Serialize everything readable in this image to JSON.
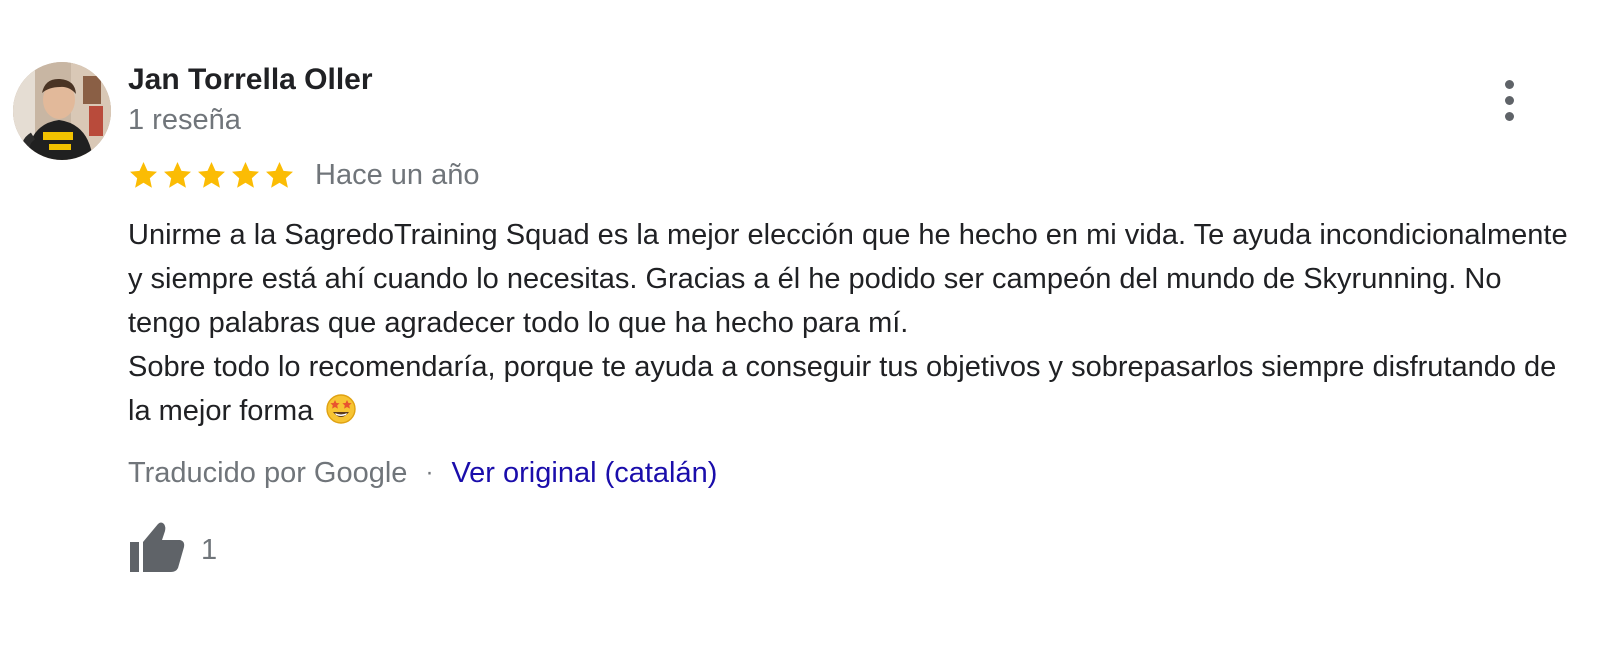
{
  "review": {
    "author_name": "Jan Torrella Oller",
    "review_count": "1 reseña",
    "rating": 5,
    "rating_max": 5,
    "date": "Hace un año",
    "text_paragraphs": [
      "Unirme a la SagredoTraining Squad es la mejor elección que he hecho en mi vida. Te ayuda incondicionalmente y siempre está ahí cuando lo necesitas. Gracias a él he podido ser campeón del mundo de Skyrunning. No tengo palabras que agradecer todo lo que ha hecho para mí.",
      "Sobre todo lo recomendaría, porque te ayuda a conseguir tus objetivos y sobrepasarlos siempre disfrutando de la mejor forma"
    ],
    "emoji": "star-struck-emoji",
    "translation_note": "Traducido por Google",
    "separator": "·",
    "original_link": "Ver original (catalán)",
    "like_count": "1"
  },
  "icons": {
    "avatar": "avatar-photo",
    "stars": "star-icon",
    "more": "more-vertical-icon",
    "like": "thumb-up-icon"
  },
  "colors": {
    "star": "#fbbc04",
    "link": "#1a0dab",
    "secondary_text": "#70757a",
    "primary_text": "#202124",
    "icon": "#5f6368"
  }
}
